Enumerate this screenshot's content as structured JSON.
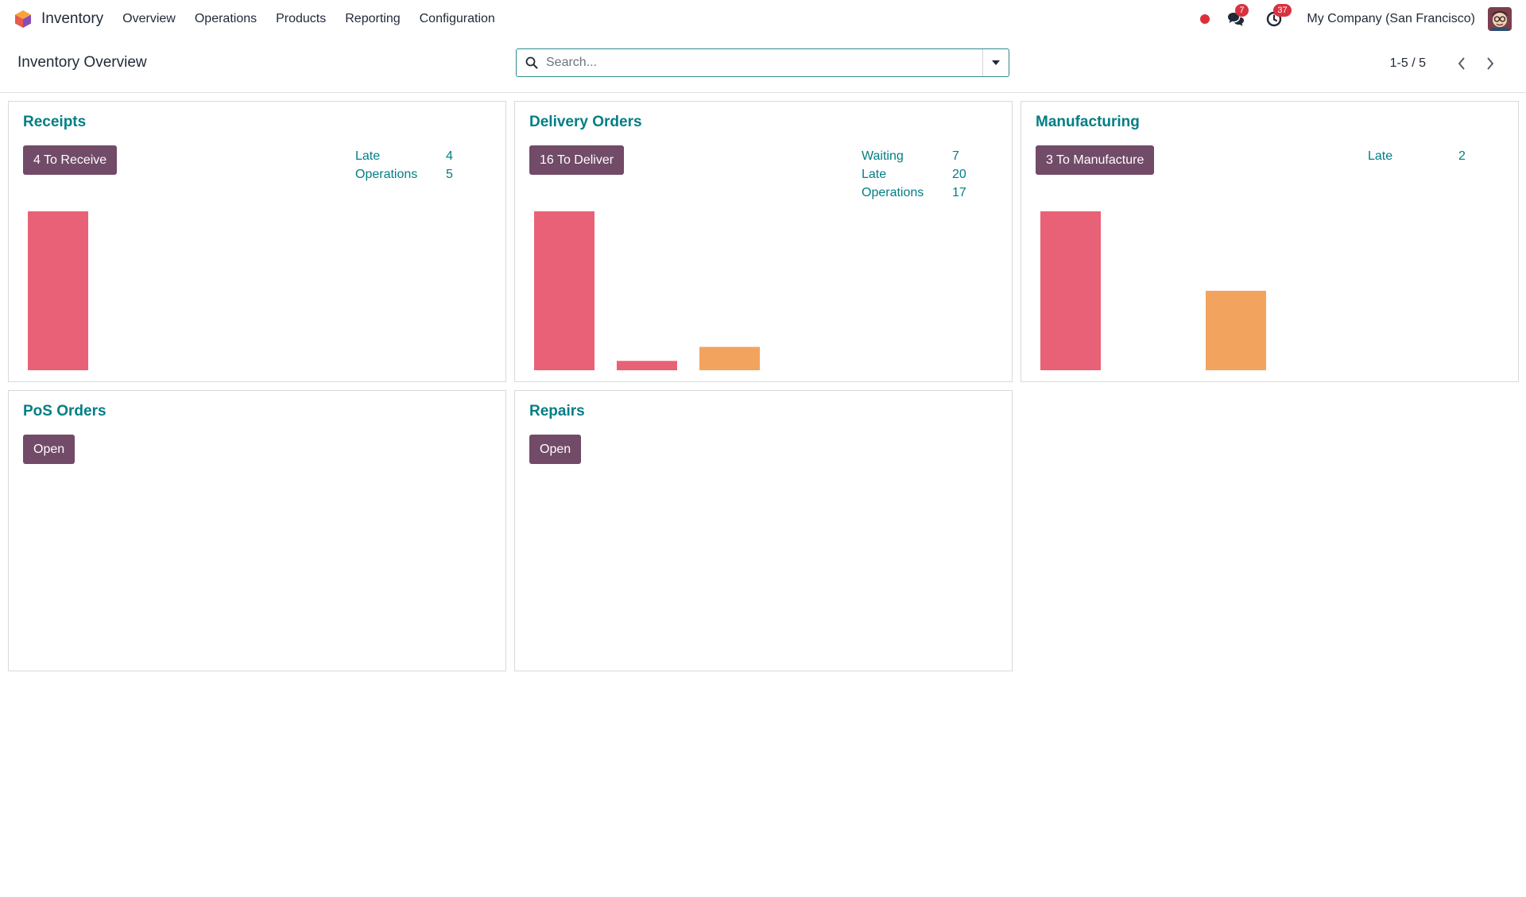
{
  "navbar": {
    "brand": "Inventory",
    "menu": [
      "Overview",
      "Operations",
      "Products",
      "Reporting",
      "Configuration"
    ],
    "messages_count": "7",
    "activities_count": "37",
    "company": "My Company (San Francisco)"
  },
  "control": {
    "title": "Inventory Overview",
    "search_placeholder": "Search...",
    "pager": "1-5 / 5"
  },
  "colors": {
    "late_bar": "#e96176",
    "future_bar": "#f2a45f",
    "accent": "#017e84",
    "button": "#714b67"
  },
  "cards": [
    {
      "title": "Receipts",
      "button": "4 To Receive",
      "stats": [
        {
          "label": "Late",
          "value": "4"
        },
        {
          "label": "Operations",
          "value": "5"
        }
      ],
      "bars": [
        {
          "value": 4,
          "color": "#e96176"
        }
      ]
    },
    {
      "title": "Delivery Orders",
      "button": "16 To Deliver",
      "stats": [
        {
          "label": "Waiting",
          "value": "7"
        },
        {
          "label": "Late",
          "value": "20"
        },
        {
          "label": "Operations",
          "value": "17"
        }
      ],
      "bars": [
        {
          "value": 17,
          "color": "#e96176"
        },
        {
          "value": 1,
          "color": "#e96176"
        },
        {
          "value": 2.5,
          "color": "#f2a45f"
        }
      ]
    },
    {
      "title": "Manufacturing",
      "button": "3 To Manufacture",
      "stats": [
        {
          "label": "Late",
          "value": "2"
        }
      ],
      "bars": [
        {
          "value": 2,
          "color": "#e96176"
        },
        {
          "value": 0,
          "color": "#e96176"
        },
        {
          "value": 1,
          "color": "#f2a45f"
        }
      ]
    },
    {
      "title": "PoS Orders",
      "button": "Open",
      "stats": [],
      "bars": []
    },
    {
      "title": "Repairs",
      "button": "Open",
      "stats": [],
      "bars": []
    }
  ]
}
